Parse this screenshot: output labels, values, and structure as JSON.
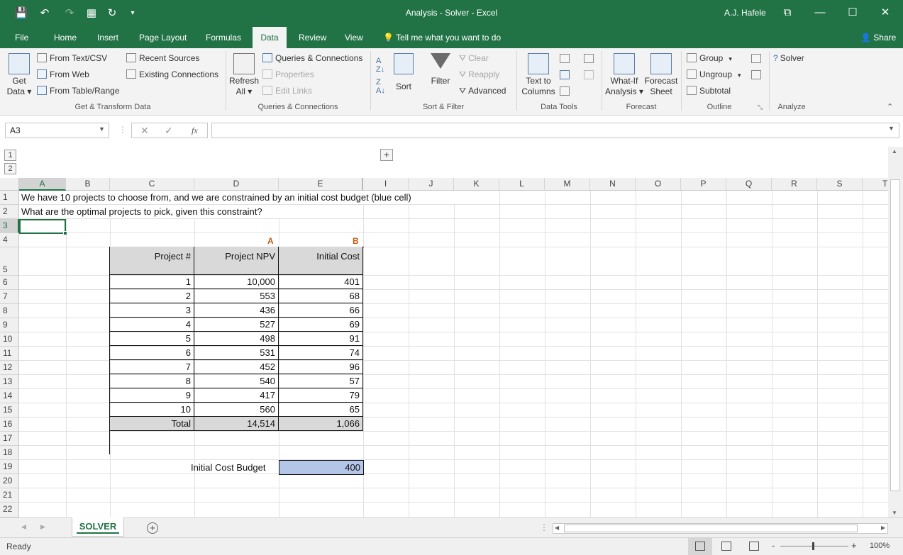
{
  "window": {
    "title": "Analysis - Solver  -  Excel",
    "user": "A.J. Hafele",
    "minimize_glyph": "—",
    "restore_glyph": "☐",
    "close_glyph": "✕",
    "ribbon_display_glyph": "⧉"
  },
  "quick_access": {
    "save_glyph": "💾",
    "undo_glyph": "↶",
    "redo_glyph": "↷",
    "table_glyph": "▦",
    "refresh_glyph": "↻",
    "more_glyph": "▾"
  },
  "tabs": [
    "File",
    "Home",
    "Insert",
    "Page Layout",
    "Formulas",
    "Data",
    "Review",
    "View"
  ],
  "active_tab": "Data",
  "tell_me": "Tell me what you want to do",
  "share": "Share",
  "ribbon": {
    "get_transform": {
      "group_label": "Get & Transform Data",
      "get_data": [
        "Get",
        "Data ▾"
      ],
      "from_text": "From Text/CSV",
      "from_web": "From Web",
      "from_table": "From Table/Range",
      "recent_sources": "Recent Sources",
      "existing_connections": "Existing Connections"
    },
    "queries": {
      "group_label": "Queries & Connections",
      "refresh_all": [
        "Refresh",
        "All ▾"
      ],
      "queries_connections": "Queries & Connections",
      "properties": "Properties",
      "edit_links": "Edit Links"
    },
    "sort_filter": {
      "group_label": "Sort & Filter",
      "sort": "Sort",
      "filter": "Filter",
      "clear": "Clear",
      "reapply": "Reapply",
      "advanced": "Advanced"
    },
    "data_tools": {
      "group_label": "Data Tools",
      "text_to_columns": [
        "Text to",
        "Columns"
      ]
    },
    "forecast": {
      "group_label": "Forecast",
      "what_if": [
        "What-If",
        "Analysis ▾"
      ],
      "forecast_sheet": [
        "Forecast",
        "Sheet"
      ]
    },
    "outline": {
      "group_label": "Outline",
      "group": "Group",
      "ungroup": "Ungroup",
      "subtotal": "Subtotal"
    },
    "analyze": {
      "group_label": "Analyze",
      "solver": "Solver"
    }
  },
  "formula_bar": {
    "name_box": "A3",
    "cancel_glyph": "✕",
    "enter_glyph": "✓",
    "fx_glyph": "fx",
    "formula": ""
  },
  "outline_levels": [
    "1",
    "2"
  ],
  "outline_expand": "+",
  "columns": [
    "A",
    "B",
    "C",
    "D",
    "E",
    "I",
    "J",
    "K",
    "L",
    "M",
    "N",
    "O",
    "P",
    "Q",
    "R",
    "S",
    "T"
  ],
  "selected_column": "A",
  "rows": [
    "1",
    "2",
    "3",
    "4",
    "5",
    "6",
    "7",
    "8",
    "9",
    "10",
    "11",
    "12",
    "13",
    "14",
    "15",
    "16",
    "17",
    "18",
    "19",
    "20",
    "21",
    "22"
  ],
  "selected_row": "3",
  "sheet": {
    "line1": "We have 10 projects to choose from, and we are constrained by an initial cost budget (blue cell)",
    "line2": "What are the optimal projects to pick, given this constraint?",
    "label_a": "A",
    "label_b": "B",
    "table": {
      "headers": [
        "Project #",
        "Project NPV",
        "Initial Cost"
      ],
      "rows": [
        [
          "1",
          "10,000",
          "401"
        ],
        [
          "2",
          "553",
          "68"
        ],
        [
          "3",
          "436",
          "66"
        ],
        [
          "4",
          "527",
          "69"
        ],
        [
          "5",
          "498",
          "91"
        ],
        [
          "6",
          "531",
          "74"
        ],
        [
          "7",
          "452",
          "96"
        ],
        [
          "8",
          "540",
          "57"
        ],
        [
          "9",
          "417",
          "79"
        ],
        [
          "10",
          "560",
          "65"
        ]
      ],
      "total": [
        "Total",
        "14,514",
        "1,066"
      ]
    },
    "budget_label": "Initial Cost Budget",
    "budget_value": "400",
    "budget_color": "#b4c6e7",
    "header_fill": "#d9d9d9"
  },
  "sheet_tabs": [
    "SOLVER"
  ],
  "add_sheet": "+",
  "status": "Ready",
  "zoom": "100%",
  "colors": {
    "excel_green": "#217346",
    "accent_orange": "#c55a11"
  }
}
